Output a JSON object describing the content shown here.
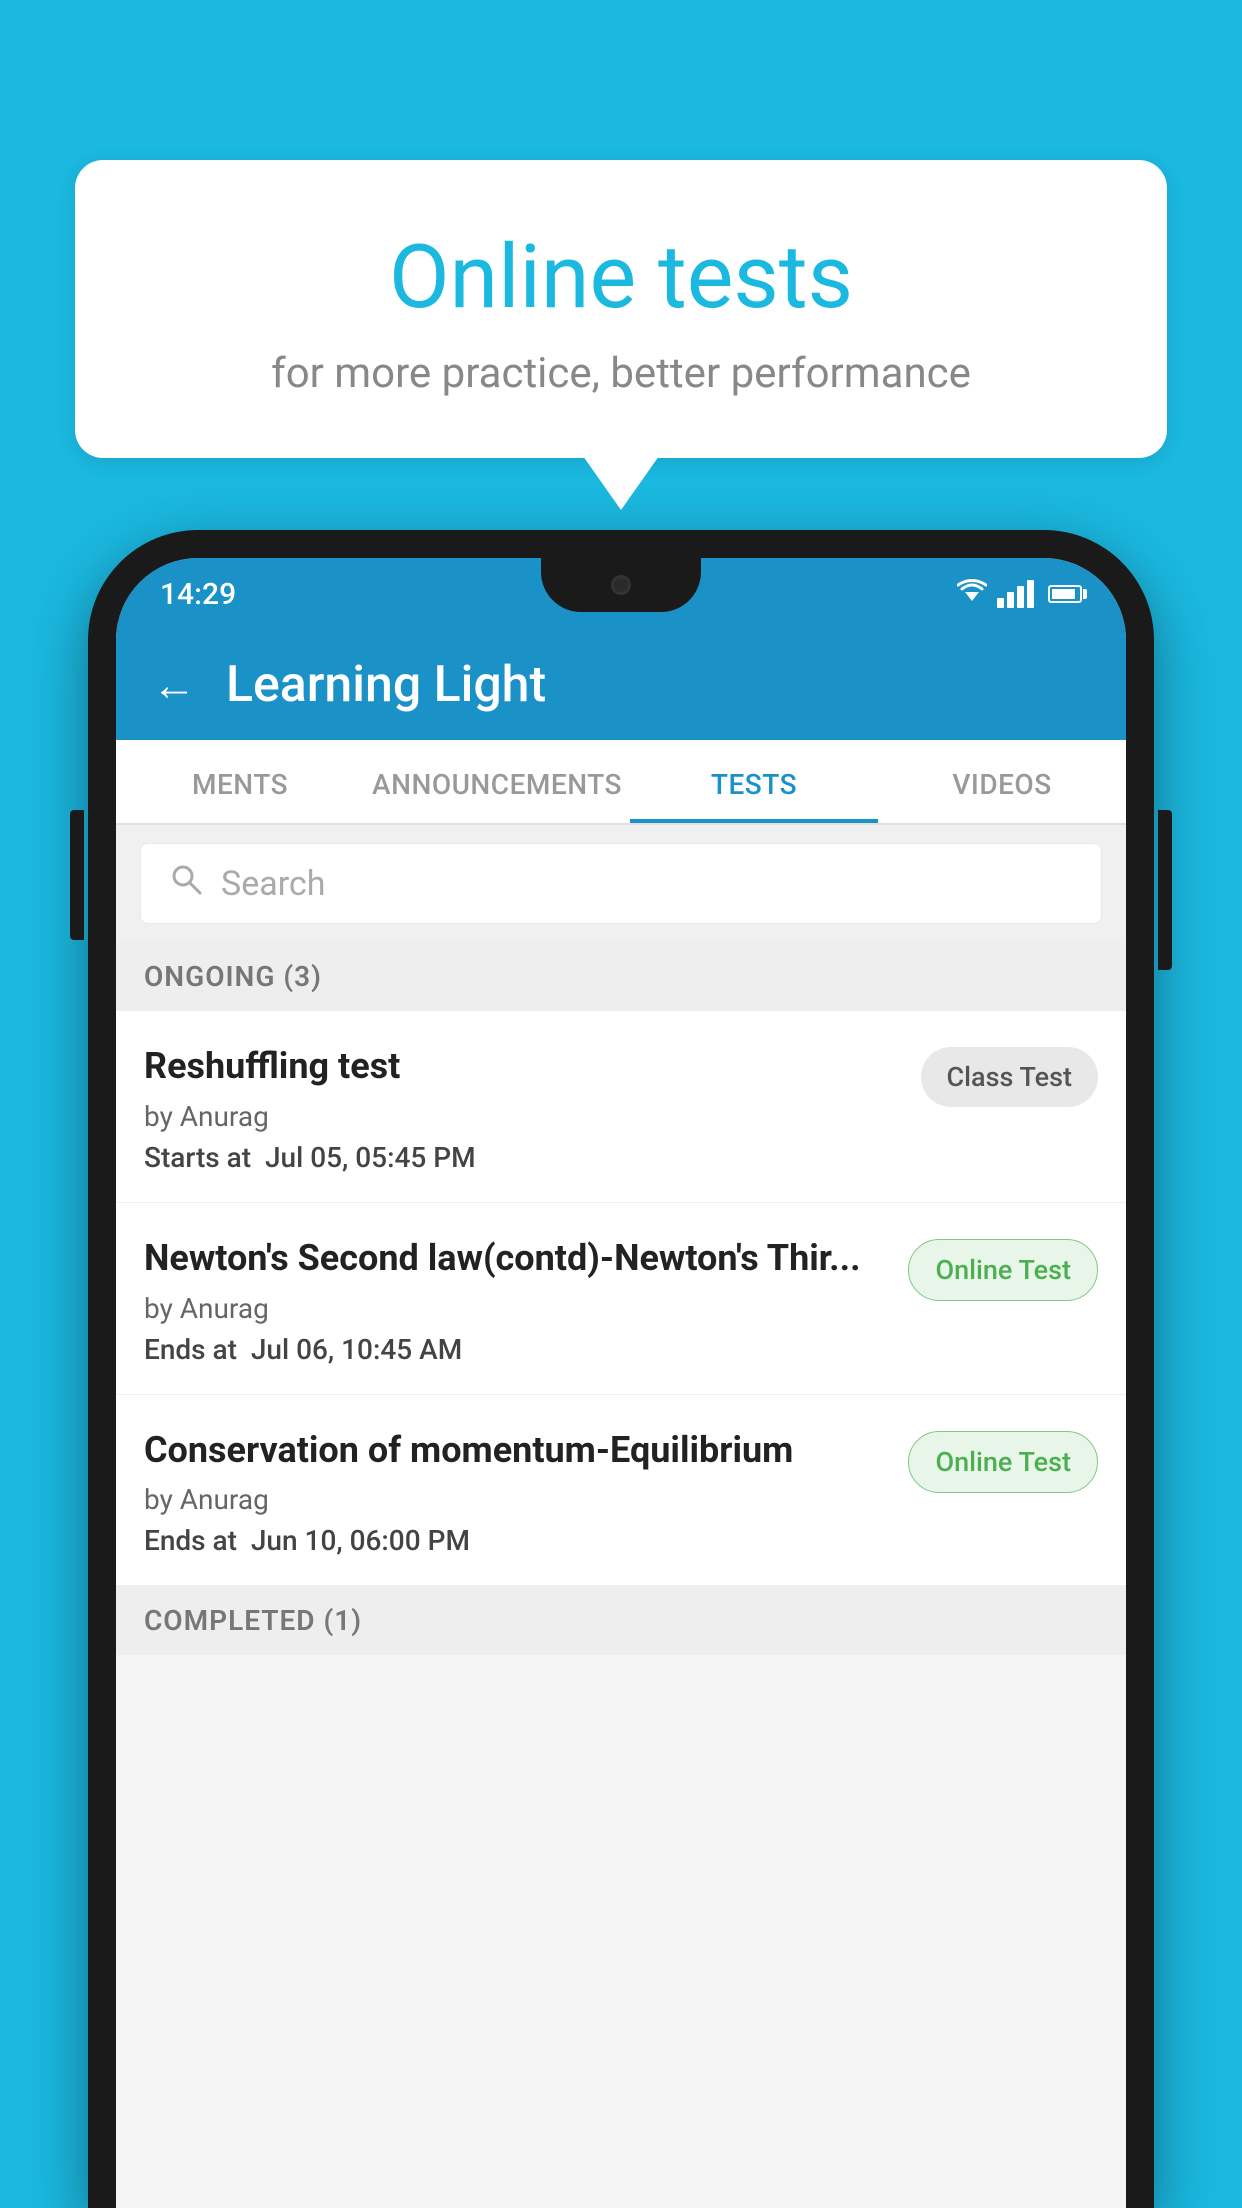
{
  "background_color": "#1bb8e0",
  "bubble": {
    "title": "Online tests",
    "subtitle": "for more practice, better performance"
  },
  "status_bar": {
    "time": "14:29",
    "wifi": "▼",
    "signal": "signal",
    "battery": "battery"
  },
  "app_bar": {
    "back_label": "←",
    "title": "Learning Light"
  },
  "tabs": [
    {
      "label": "MENTS",
      "active": false
    },
    {
      "label": "ANNOUNCEMENTS",
      "active": false
    },
    {
      "label": "TESTS",
      "active": true
    },
    {
      "label": "VIDEOS",
      "active": false
    }
  ],
  "search": {
    "placeholder": "Search"
  },
  "sections": [
    {
      "title": "ONGOING (3)",
      "tests": [
        {
          "title": "Reshuffling test",
          "author": "by Anurag",
          "date_label": "Starts at",
          "date": "Jul 05, 05:45 PM",
          "badge": "Class Test",
          "badge_type": "class"
        },
        {
          "title": "Newton's Second law(contd)-Newton's Thir...",
          "author": "by Anurag",
          "date_label": "Ends at",
          "date": "Jul 06, 10:45 AM",
          "badge": "Online Test",
          "badge_type": "online"
        },
        {
          "title": "Conservation of momentum-Equilibrium",
          "author": "by Anurag",
          "date_label": "Ends at",
          "date": "Jun 10, 06:00 PM",
          "badge": "Online Test",
          "badge_type": "online"
        }
      ]
    }
  ],
  "completed_section": {
    "title": "COMPLETED (1)"
  }
}
